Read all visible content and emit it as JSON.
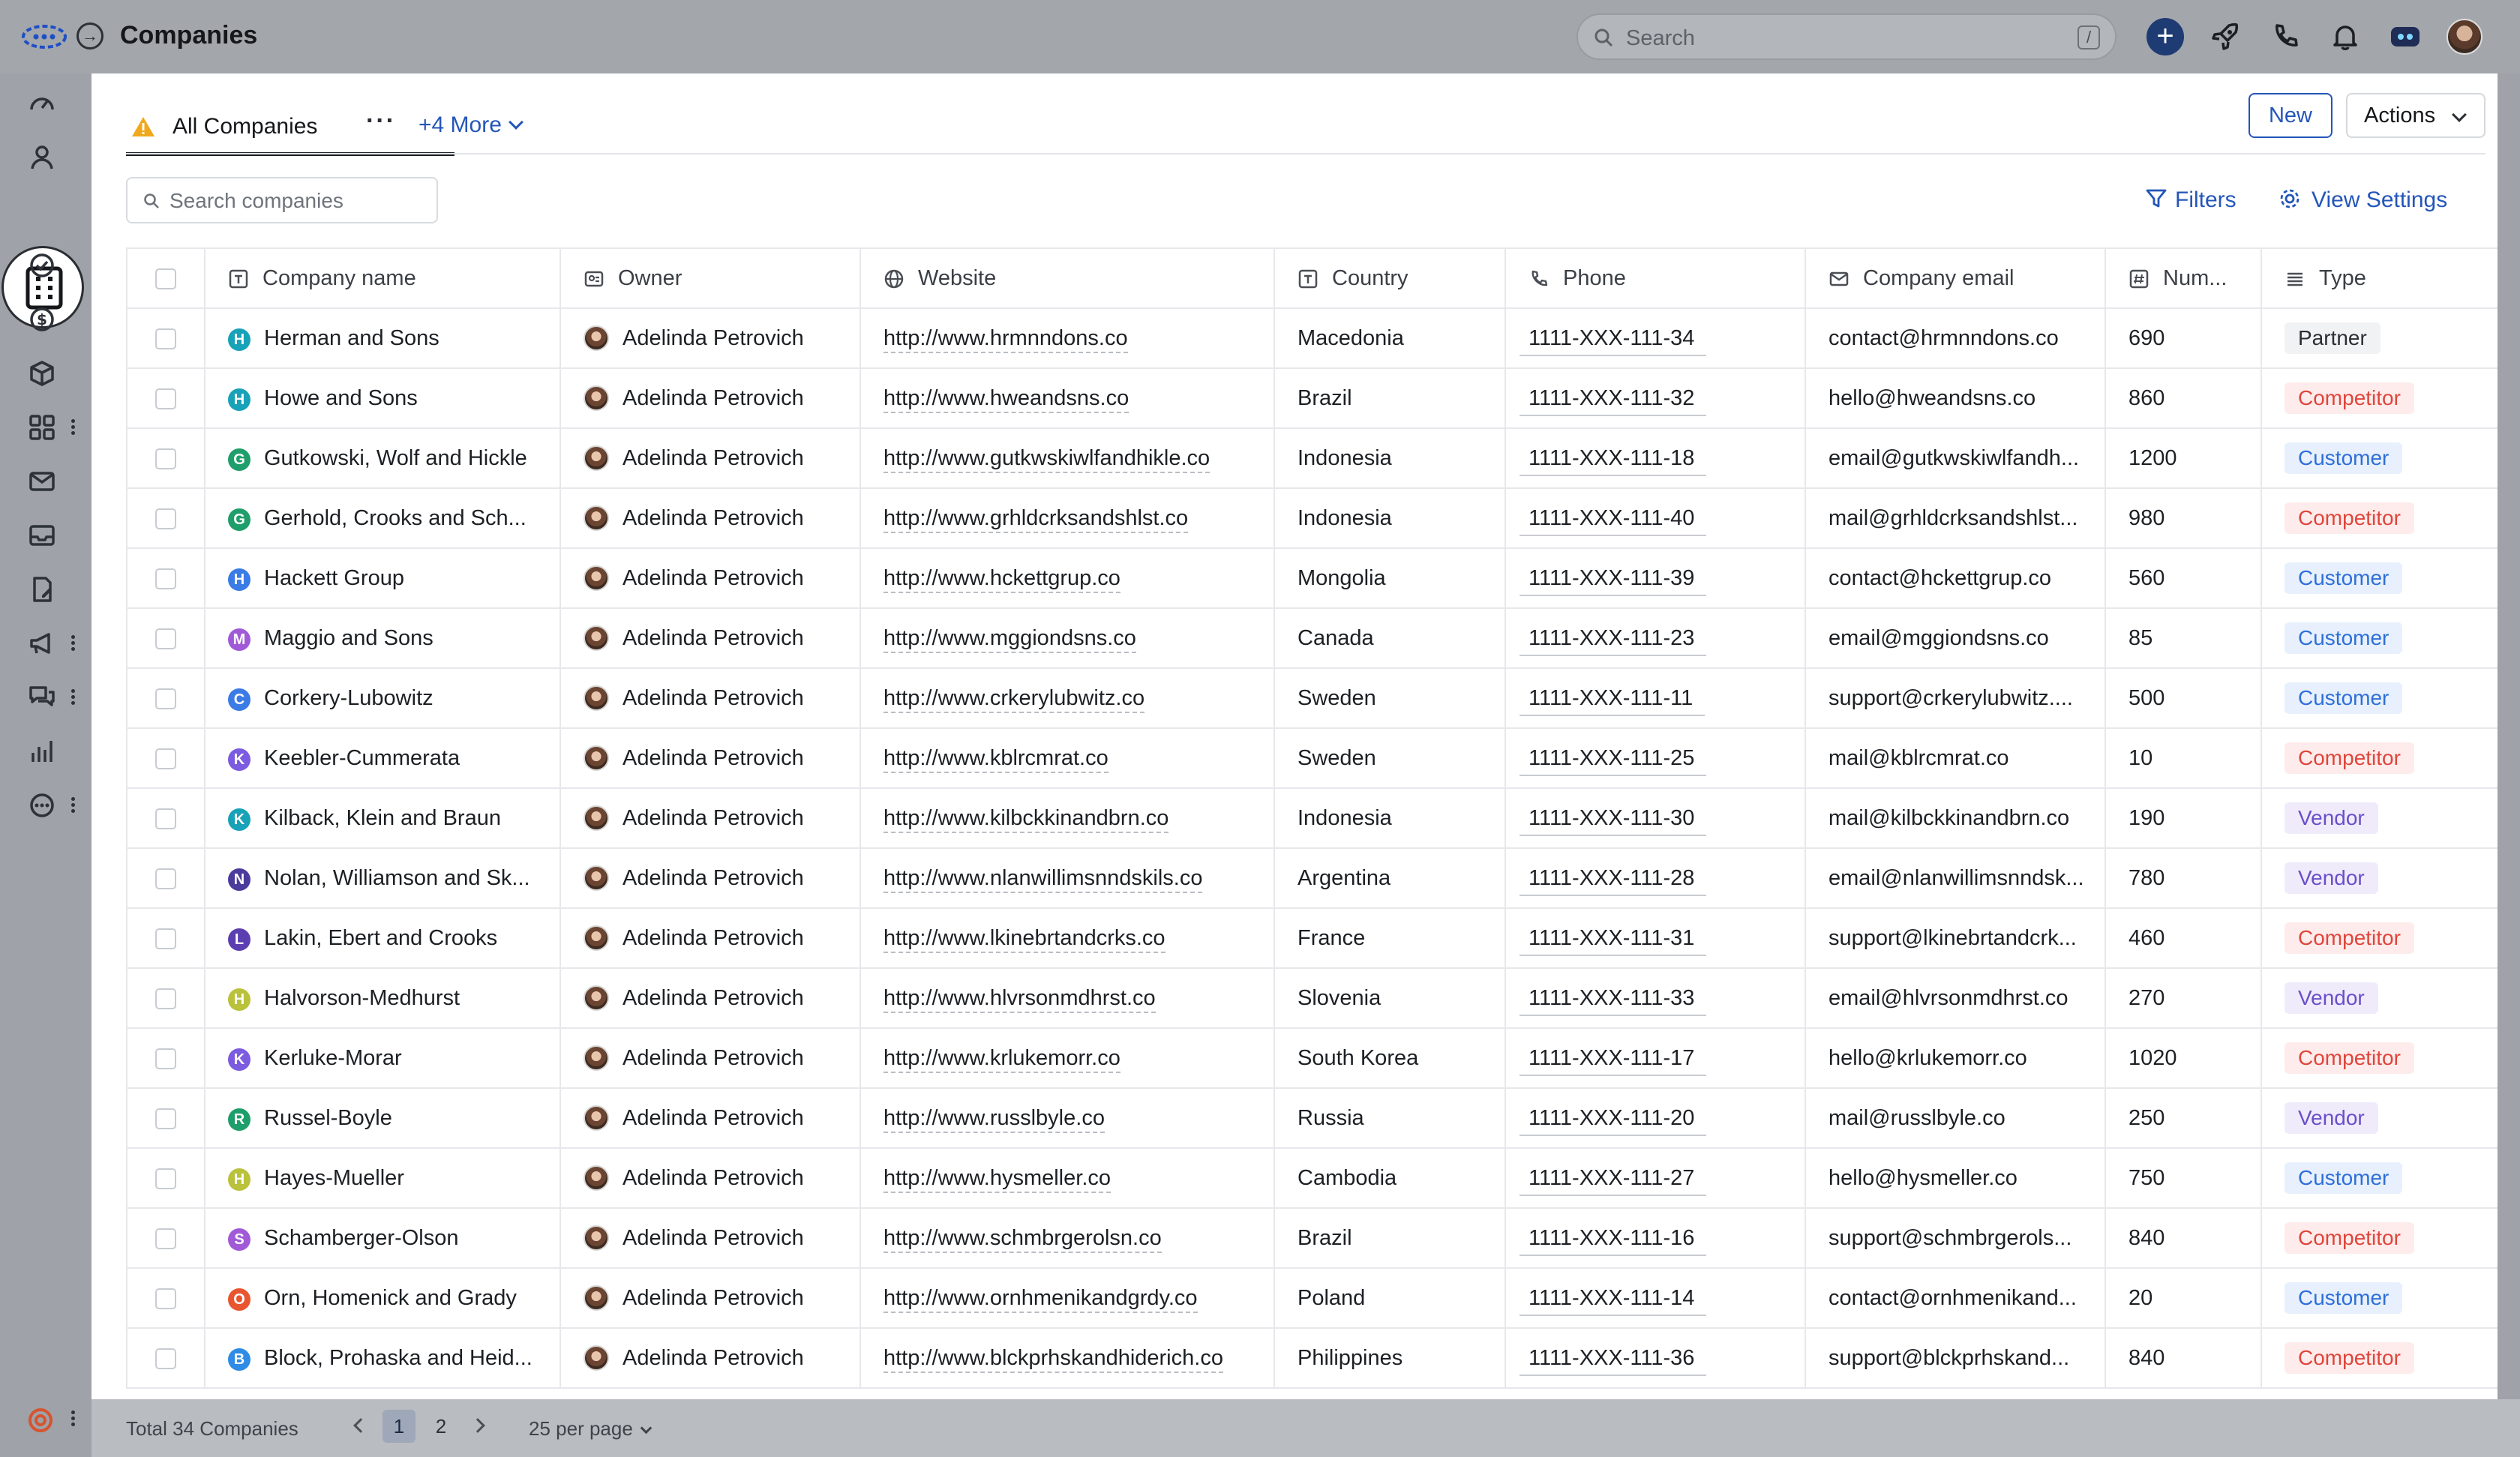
{
  "app": {
    "title": "Companies",
    "search_placeholder": "Search",
    "search_shortcut": "/"
  },
  "view": {
    "current": "All Companies",
    "more_views": "+4 More",
    "new_label": "New",
    "actions_label": "Actions",
    "search_placeholder": "Search companies",
    "filters_label": "Filters",
    "view_settings_label": "View Settings"
  },
  "table": {
    "columns": [
      "Company name",
      "Owner",
      "Website",
      "Country",
      "Phone",
      "Company email",
      "Num...",
      "Type"
    ],
    "rows": [
      {
        "initial": "H",
        "color": "#17a2b8",
        "name": "Herman and Sons",
        "owner": "Adelinda Petrovich",
        "website": "http://www.hrmnndons.co",
        "country": "Macedonia",
        "phone": "1111-XXX-111-34",
        "email": "contact@hrmnndons.co",
        "num": "690",
        "type": "Partner"
      },
      {
        "initial": "H",
        "color": "#17a2b8",
        "name": "Howe and Sons",
        "owner": "Adelinda Petrovich",
        "website": "http://www.hweandsns.co",
        "country": "Brazil",
        "phone": "1111-XXX-111-32",
        "email": "hello@hweandsns.co",
        "num": "860",
        "type": "Competitor"
      },
      {
        "initial": "G",
        "color": "#1e9e6a",
        "name": "Gutkowski, Wolf and Hickle",
        "owner": "Adelinda Petrovich",
        "website": "http://www.gutkwskiwlfandhikle.co",
        "country": "Indonesia",
        "phone": "1111-XXX-111-18",
        "email": "email@gutkwskiwlfandh...",
        "num": "1200",
        "type": "Customer"
      },
      {
        "initial": "G",
        "color": "#1e9e6a",
        "name": "Gerhold, Crooks and Sch...",
        "owner": "Adelinda Petrovich",
        "website": "http://www.grhldcrksandshlst.co",
        "country": "Indonesia",
        "phone": "1111-XXX-111-40",
        "email": "mail@grhldcrksandshlst...",
        "num": "980",
        "type": "Competitor"
      },
      {
        "initial": "H",
        "color": "#3b7be6",
        "name": "Hackett Group",
        "owner": "Adelinda Petrovich",
        "website": "http://www.hckettgrup.co",
        "country": "Mongolia",
        "phone": "1111-XXX-111-39",
        "email": "contact@hckettgrup.co",
        "num": "560",
        "type": "Customer"
      },
      {
        "initial": "M",
        "color": "#a05ad8",
        "name": "Maggio and Sons",
        "owner": "Adelinda Petrovich",
        "website": "http://www.mggiondsns.co",
        "country": "Canada",
        "phone": "1111-XXX-111-23",
        "email": "email@mggiondsns.co",
        "num": "85",
        "type": "Customer"
      },
      {
        "initial": "C",
        "color": "#3b7be6",
        "name": "Corkery-Lubowitz",
        "owner": "Adelinda Petrovich",
        "website": "http://www.crkerylubwitz.co",
        "country": "Sweden",
        "phone": "1111-XXX-111-11",
        "email": "support@crkerylubwitz....",
        "num": "500",
        "type": "Customer"
      },
      {
        "initial": "K",
        "color": "#7b5be0",
        "name": "Keebler-Cummerata",
        "owner": "Adelinda Petrovich",
        "website": "http://www.kblrcmrat.co",
        "country": "Sweden",
        "phone": "1111-XXX-111-25",
        "email": "mail@kblrcmrat.co",
        "num": "10",
        "type": "Competitor"
      },
      {
        "initial": "K",
        "color": "#17a2b8",
        "name": "Kilback, Klein and Braun",
        "owner": "Adelinda Petrovich",
        "website": "http://www.kilbckkinandbrn.co",
        "country": "Indonesia",
        "phone": "1111-XXX-111-30",
        "email": "mail@kilbckkinandbrn.co",
        "num": "190",
        "type": "Vendor"
      },
      {
        "initial": "N",
        "color": "#4b3b9c",
        "name": "Nolan, Williamson and Sk...",
        "owner": "Adelinda Petrovich",
        "website": "http://www.nlanwillimsnndskils.co",
        "country": "Argentina",
        "phone": "1111-XXX-111-28",
        "email": "email@nlanwillimsnndsk...",
        "num": "780",
        "type": "Vendor"
      },
      {
        "initial": "L",
        "color": "#5b3fb0",
        "name": "Lakin, Ebert and Crooks",
        "owner": "Adelinda Petrovich",
        "website": "http://www.lkinebrtandcrks.co",
        "country": "France",
        "phone": "1111-XXX-111-31",
        "email": "support@lkinebrtandcrk...",
        "num": "460",
        "type": "Competitor"
      },
      {
        "initial": "H",
        "color": "#b9c23a",
        "name": "Halvorson-Medhurst",
        "owner": "Adelinda Petrovich",
        "website": "http://www.hlvrsonmdhrst.co",
        "country": "Slovenia",
        "phone": "1111-XXX-111-33",
        "email": "email@hlvrsonmdhrst.co",
        "num": "270",
        "type": "Vendor"
      },
      {
        "initial": "K",
        "color": "#7b5be0",
        "name": "Kerluke-Morar",
        "owner": "Adelinda Petrovich",
        "website": "http://www.krlukemorr.co",
        "country": "South Korea",
        "phone": "1111-XXX-111-17",
        "email": "hello@krlukemorr.co",
        "num": "1020",
        "type": "Competitor"
      },
      {
        "initial": "R",
        "color": "#1e9e6a",
        "name": "Russel-Boyle",
        "owner": "Adelinda Petrovich",
        "website": "http://www.russlbyle.co",
        "country": "Russia",
        "phone": "1111-XXX-111-20",
        "email": "mail@russlbyle.co",
        "num": "250",
        "type": "Vendor"
      },
      {
        "initial": "H",
        "color": "#b9c23a",
        "name": "Hayes-Mueller",
        "owner": "Adelinda Petrovich",
        "website": "http://www.hysmeller.co",
        "country": "Cambodia",
        "phone": "1111-XXX-111-27",
        "email": "hello@hysmeller.co",
        "num": "750",
        "type": "Customer"
      },
      {
        "initial": "S",
        "color": "#a05ad8",
        "name": "Schamberger-Olson",
        "owner": "Adelinda Petrovich",
        "website": "http://www.schmbrgerolsn.co",
        "country": "Brazil",
        "phone": "1111-XXX-111-16",
        "email": "support@schmbrgerols...",
        "num": "840",
        "type": "Competitor"
      },
      {
        "initial": "O",
        "color": "#e8552f",
        "name": "Orn, Homenick and Grady",
        "owner": "Adelinda Petrovich",
        "website": "http://www.ornhmenikandgrdy.co",
        "country": "Poland",
        "phone": "1111-XXX-111-14",
        "email": "contact@ornhmenikand...",
        "num": "20",
        "type": "Customer"
      },
      {
        "initial": "B",
        "color": "#2e8be6",
        "name": "Block, Prohaska and Heid...",
        "owner": "Adelinda Petrovich",
        "website": "http://www.blckprhskandhiderich.co",
        "country": "Philippines",
        "phone": "1111-XXX-111-36",
        "email": "support@blckprhskand...",
        "num": "840",
        "type": "Competitor"
      }
    ]
  },
  "footer": {
    "total": "Total 34 Companies",
    "pages": [
      "1",
      "2"
    ],
    "current_page": "1",
    "per_page": "25 per page"
  }
}
